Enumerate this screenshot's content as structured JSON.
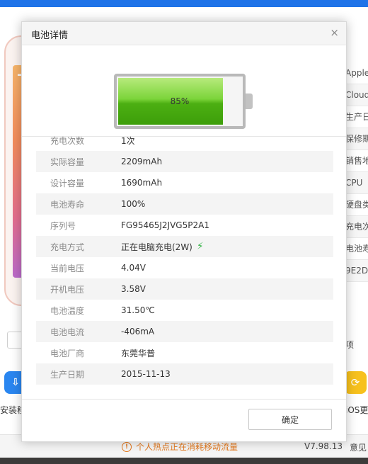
{
  "background": {
    "right_column": [
      "Apple",
      "Cloud",
      "生产日",
      "保修期",
      "销售地",
      "CPU",
      "硬盘类",
      "充电次",
      "电池寿",
      "9E2D"
    ],
    "right_extra": "项",
    "left_app_label": "安装移",
    "right_app_label": "iOS更新",
    "hotspot_text": "个人热点正在消耗移动流量",
    "version": "V7.98.13",
    "feedback": "意见"
  },
  "dialog": {
    "title": "电池详情",
    "close_glyph": "×",
    "battery": {
      "level_label": "85%",
      "level_fraction": 0.85
    },
    "rows": [
      {
        "label": "充电次数",
        "value": "1次"
      },
      {
        "label": "实际容量",
        "value": "2209mAh"
      },
      {
        "label": "设计容量",
        "value": "1690mAh"
      },
      {
        "label": "电池寿命",
        "value": "100%"
      },
      {
        "label": "序列号",
        "value": "FG95465J2JVG5P2A1"
      },
      {
        "label": "充电方式",
        "value": "正在电脑充电(2W)"
      },
      {
        "label": "当前电压",
        "value": "4.04V"
      },
      {
        "label": "开机电压",
        "value": "3.58V"
      },
      {
        "label": "电池温度",
        "value": "31.50℃"
      },
      {
        "label": "电池电流",
        "value": "-406mA"
      },
      {
        "label": "电池厂商",
        "value": "东莞华普"
      },
      {
        "label": "生产日期",
        "value": "2015-11-13"
      }
    ],
    "ok_label": "确定"
  },
  "colors": {
    "accent_blue": "#1f73e8",
    "battery_green": "#4caf12",
    "warning_orange": "#e3771b",
    "bolt_green": "#39b54a"
  }
}
